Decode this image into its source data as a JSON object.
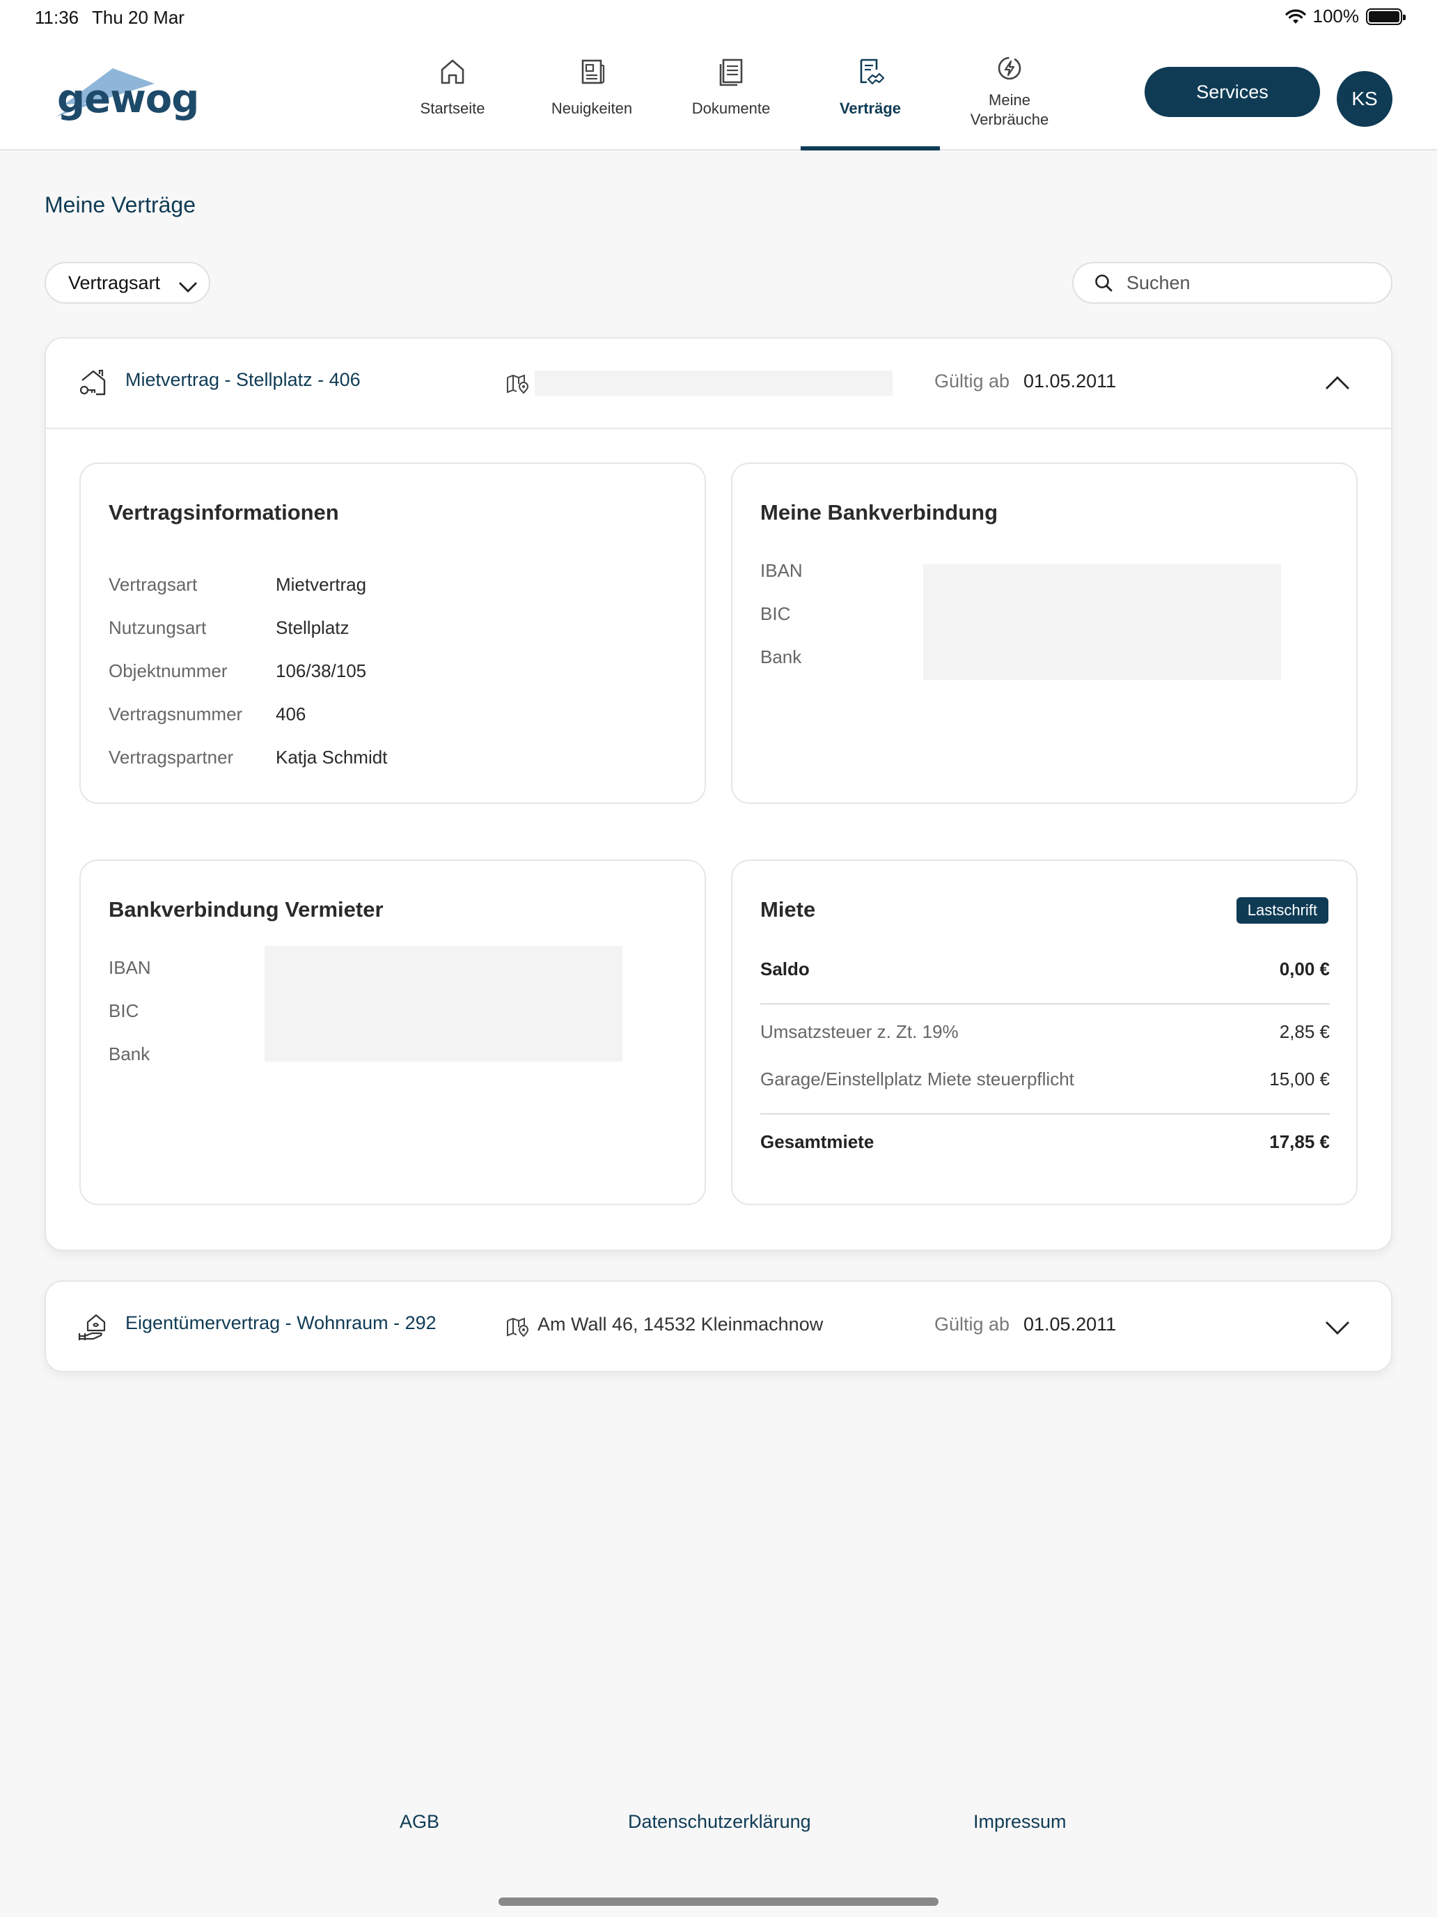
{
  "status_bar": {
    "time": "11:36",
    "date": "Thu 20 Mar",
    "battery": "100%"
  },
  "header": {
    "logo_text": "gewog",
    "nav": [
      {
        "label": "Startseite",
        "icon": "home-icon"
      },
      {
        "label": "Neuigkeiten",
        "icon": "newspaper-icon"
      },
      {
        "label": "Dokumente",
        "icon": "document-icon"
      },
      {
        "label": "Verträge",
        "icon": "contract-icon",
        "active": true
      },
      {
        "label": "Meine\nVerbräuche",
        "icon": "energy-icon"
      }
    ],
    "services_label": "Services",
    "avatar_initials": "KS"
  },
  "page": {
    "title": "Meine Verträge",
    "filter_label": "Vertragsart",
    "search_placeholder": "Suchen"
  },
  "contracts": [
    {
      "title": "Mietvertrag - Stellplatz - 406",
      "address": "",
      "valid_label": "Gültig ab",
      "valid_date": "01.05.2011",
      "expanded": true,
      "details": {
        "title": "Vertragsinformationen",
        "rows": [
          {
            "key": "Vertragsart",
            "value": "Mietvertrag"
          },
          {
            "key": "Nutzungsart",
            "value": "Stellplatz"
          },
          {
            "key": "Objektnummer",
            "value": "106/38/105"
          },
          {
            "key": "Vertragsnummer",
            "value": "406"
          },
          {
            "key": "Vertragspartner",
            "value": "Katja Schmidt"
          }
        ]
      },
      "own_bank": {
        "title": "Meine Bankverbindung",
        "labels": [
          "IBAN",
          "BIC",
          "Bank"
        ]
      },
      "landlord_bank": {
        "title": "Bankverbindung Vermieter",
        "labels": [
          "IBAN",
          "BIC",
          "Bank"
        ]
      },
      "rent": {
        "title": "Miete",
        "badge": "Lastschrift",
        "saldo_label": "Saldo",
        "saldo_value": "0,00 €",
        "items": [
          {
            "label": "Umsatzsteuer z. Zt. 19%",
            "value": "2,85 €"
          },
          {
            "label": "Garage/Einstellplatz Miete steuerpflicht",
            "value": "15,00 €"
          }
        ],
        "total_label": "Gesamtmiete",
        "total_value": "17,85 €"
      }
    },
    {
      "title": "Eigentümervertrag - Wohnraum - 292",
      "address": "Am Wall 46, 14532 Kleinmachnow",
      "valid_label": "Gültig ab",
      "valid_date": "01.05.2011",
      "expanded": false
    }
  ],
  "footer": {
    "links": [
      "AGB",
      "Datenschutzerklärung",
      "Impressum"
    ]
  },
  "colors": {
    "primary": "#0f3b55",
    "background": "#f7f7f7",
    "logo_accent": "#8fb6d8"
  }
}
